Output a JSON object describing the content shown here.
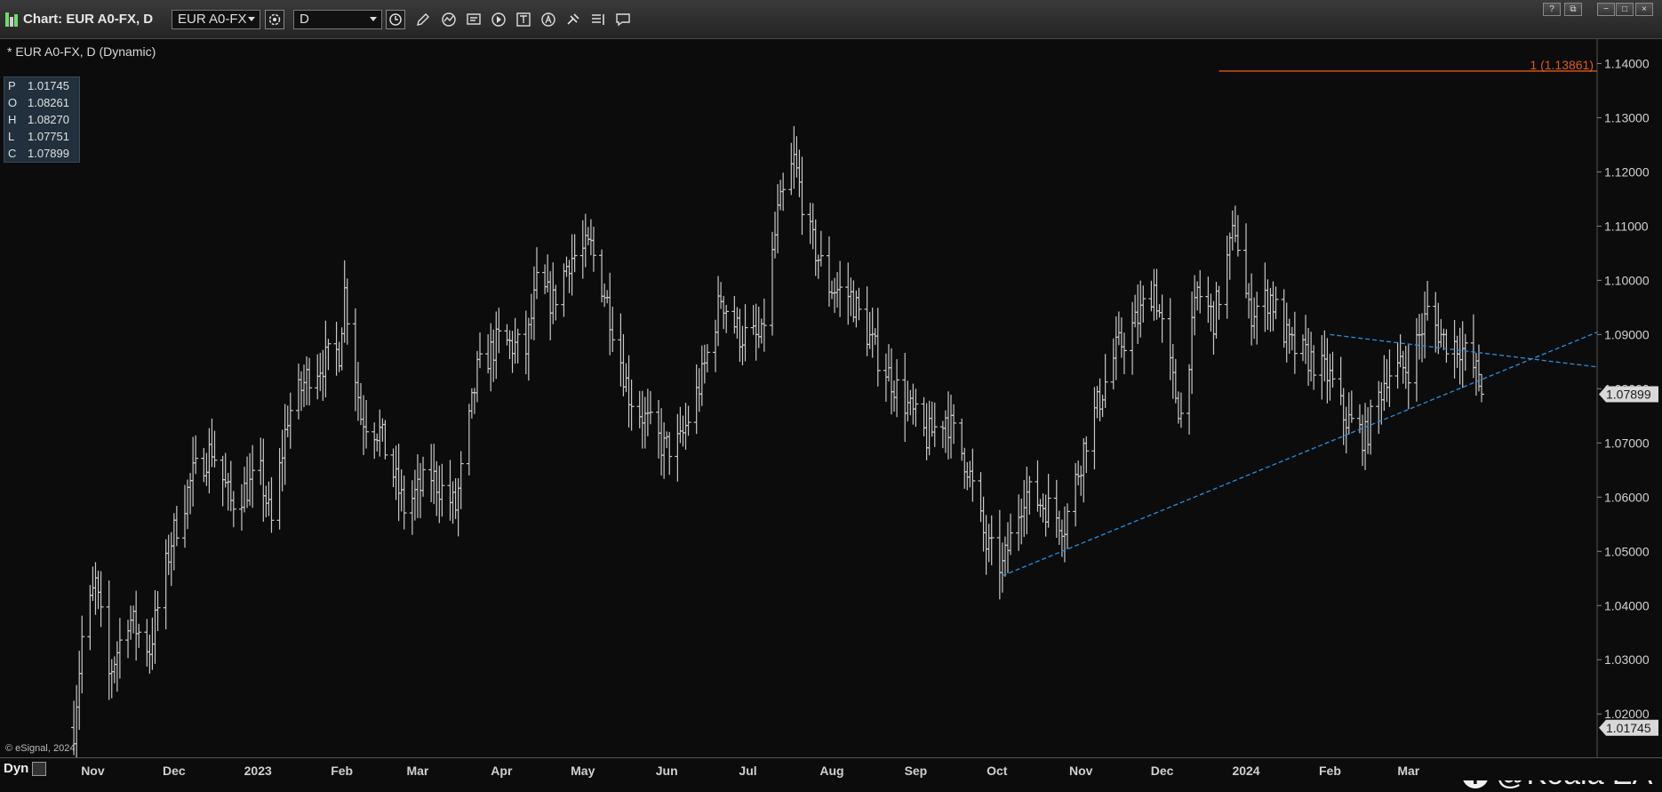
{
  "window": {
    "title": "Chart: EUR A0-FX, D",
    "symbol_value": "EUR A0-FX",
    "interval_value": "D",
    "controls": [
      "help-icon",
      "restore-icon",
      "minimize-icon",
      "maximize-icon",
      "close-icon"
    ],
    "win_labels": [
      "?",
      "⧉",
      "−",
      "□",
      "×"
    ]
  },
  "toolbar_icons": [
    "clock-icon",
    "pencil-icon",
    "studies-icon",
    "chart-type-icon",
    "play-icon",
    "text-icon",
    "alert-icon",
    "link-icon",
    "list-icon",
    "comment-icon"
  ],
  "chart": {
    "label": "* EUR A0-FX, D (Dynamic)",
    "ohlc": [
      {
        "key": "P",
        "value": "1.01745"
      },
      {
        "key": "O",
        "value": "1.08261"
      },
      {
        "key": "H",
        "value": "1.08270"
      },
      {
        "key": "L",
        "value": "1.07751"
      },
      {
        "key": "C",
        "value": "1.07899"
      }
    ],
    "copyright": "© eSignal, 2024",
    "watermark": "@Koala EA",
    "watermark_icon": "facebook-icon",
    "dyn_label": "Dyn"
  },
  "colors": {
    "bars": "#c8c8c8",
    "trendline": "#2a8ee0",
    "hline": "#e05a18",
    "axis_text": "#d0d0d0"
  },
  "chart_data": {
    "type": "ohlc",
    "symbol": "EUR A0-FX",
    "interval": "D",
    "ylim": [
      1.012,
      1.1445
    ],
    "yticks": [
      1.02,
      1.03,
      1.04,
      1.05,
      1.06,
      1.07,
      1.08,
      1.09,
      1.1,
      1.11,
      1.12,
      1.13,
      1.14
    ],
    "ytick_labels": [
      "1.02000",
      "1.03000",
      "1.04000",
      "1.05000",
      "1.06000",
      "1.07000",
      "1.08000",
      "1.09000",
      "1.10000",
      "1.11000",
      "1.12000",
      "1.13000",
      "1.14000"
    ],
    "month_labels": [
      "Nov",
      "Dec",
      "2023",
      "Feb",
      "Mar",
      "Apr",
      "May",
      "Jun",
      "Jul",
      "Aug",
      "Sep",
      "Oct",
      "Nov",
      "Dec",
      "2024",
      "Feb",
      "Mar"
    ],
    "month_starts": [
      "2022-11-01",
      "2022-12-01",
      "2023-01-01",
      "2023-02-01",
      "2023-03-01",
      "2023-04-01",
      "2023-05-01",
      "2023-06-01",
      "2023-07-01",
      "2023-08-01",
      "2023-09-01",
      "2023-10-01",
      "2023-11-01",
      "2023-12-01",
      "2024-01-01",
      "2024-02-01",
      "2024-03-01"
    ],
    "close_path": [
      [
        "2022-10-25",
        1.0175
      ],
      [
        "2022-10-28",
        1.034
      ],
      [
        "2022-11-02",
        1.044
      ],
      [
        "2022-11-07",
        1.027
      ],
      [
        "2022-11-14",
        1.038
      ],
      [
        "2022-11-22",
        1.032
      ],
      [
        "2022-11-30",
        1.052
      ],
      [
        "2022-12-08",
        1.064
      ],
      [
        "2022-12-15",
        1.069
      ],
      [
        "2022-12-22",
        1.059
      ],
      [
        "2023-01-02",
        1.064
      ],
      [
        "2023-01-06",
        1.055
      ],
      [
        "2023-01-12",
        1.075
      ],
      [
        "2023-01-20",
        1.083
      ],
      [
        "2023-01-31",
        1.087
      ],
      [
        "2023-02-02",
        1.098
      ],
      [
        "2023-02-08",
        1.075
      ],
      [
        "2023-02-15",
        1.072
      ],
      [
        "2023-02-24",
        1.058
      ],
      [
        "2023-03-06",
        1.064
      ],
      [
        "2023-03-15",
        1.058
      ],
      [
        "2023-03-23",
        1.083
      ],
      [
        "2023-03-31",
        1.089
      ],
      [
        "2023-04-10",
        1.087
      ],
      [
        "2023-04-14",
        1.099
      ],
      [
        "2023-04-20",
        1.096
      ],
      [
        "2023-04-26",
        1.104
      ],
      [
        "2023-05-04",
        1.106
      ],
      [
        "2023-05-10",
        1.096
      ],
      [
        "2023-05-18",
        1.079
      ],
      [
        "2023-05-31",
        1.069
      ],
      [
        "2023-06-06",
        1.07
      ],
      [
        "2023-06-14",
        1.082
      ],
      [
        "2023-06-21",
        1.097
      ],
      [
        "2023-06-28",
        1.09
      ],
      [
        "2023-07-06",
        1.089
      ],
      [
        "2023-07-12",
        1.112
      ],
      [
        "2023-07-18",
        1.122
      ],
      [
        "2023-07-24",
        1.108
      ],
      [
        "2023-07-31",
        1.099
      ],
      [
        "2023-08-08",
        1.097
      ],
      [
        "2023-08-17",
        1.087
      ],
      [
        "2023-08-25",
        1.08
      ],
      [
        "2023-09-05",
        1.071
      ],
      [
        "2023-09-12",
        1.075
      ],
      [
        "2023-09-20",
        1.066
      ],
      [
        "2023-09-27",
        1.051
      ],
      [
        "2023-10-03",
        1.047
      ],
      [
        "2023-10-11",
        1.061
      ],
      [
        "2023-10-20",
        1.058
      ],
      [
        "2023-10-26",
        1.055
      ],
      [
        "2023-11-03",
        1.071
      ],
      [
        "2023-11-14",
        1.087
      ],
      [
        "2023-11-21",
        1.092
      ],
      [
        "2023-11-28",
        1.099
      ],
      [
        "2023-12-05",
        1.081
      ],
      [
        "2023-12-08",
        1.075
      ],
      [
        "2023-12-14",
        1.098
      ],
      [
        "2023-12-20",
        1.093
      ],
      [
        "2023-12-28",
        1.11
      ],
      [
        "2024-01-02",
        1.094
      ],
      [
        "2024-01-10",
        1.097
      ],
      [
        "2024-01-17",
        1.088
      ],
      [
        "2024-01-26",
        1.085
      ],
      [
        "2024-02-01",
        1.082
      ],
      [
        "2024-02-06",
        1.075
      ],
      [
        "2024-02-14",
        1.071
      ],
      [
        "2024-02-22",
        1.083
      ],
      [
        "2024-03-01",
        1.084
      ],
      [
        "2024-03-08",
        1.094
      ],
      [
        "2024-03-14",
        1.089
      ],
      [
        "2024-03-20",
        1.088
      ],
      [
        "2024-03-26",
        1.083
      ],
      [
        "2024-03-28",
        1.079
      ]
    ],
    "last_bar": {
      "open": 1.08261,
      "high": 1.0827,
      "low": 1.07751,
      "close": 1.07899
    },
    "price_markers": [
      {
        "value": 1.07899,
        "label": "1.07899"
      },
      {
        "value": 1.01745,
        "label": "1.01745"
      }
    ],
    "horizontal_line": {
      "value": 1.13861,
      "label": "1 (1.13861)",
      "start": "2023-12-22"
    },
    "trendlines": [
      {
        "from": [
          "2023-10-03",
          1.0455
        ],
        "to": [
          "2024-05-10",
          1.0905
        ]
      },
      {
        "from": [
          "2024-02-01",
          1.09
        ],
        "to": [
          "2024-05-10",
          1.084
        ]
      }
    ]
  }
}
